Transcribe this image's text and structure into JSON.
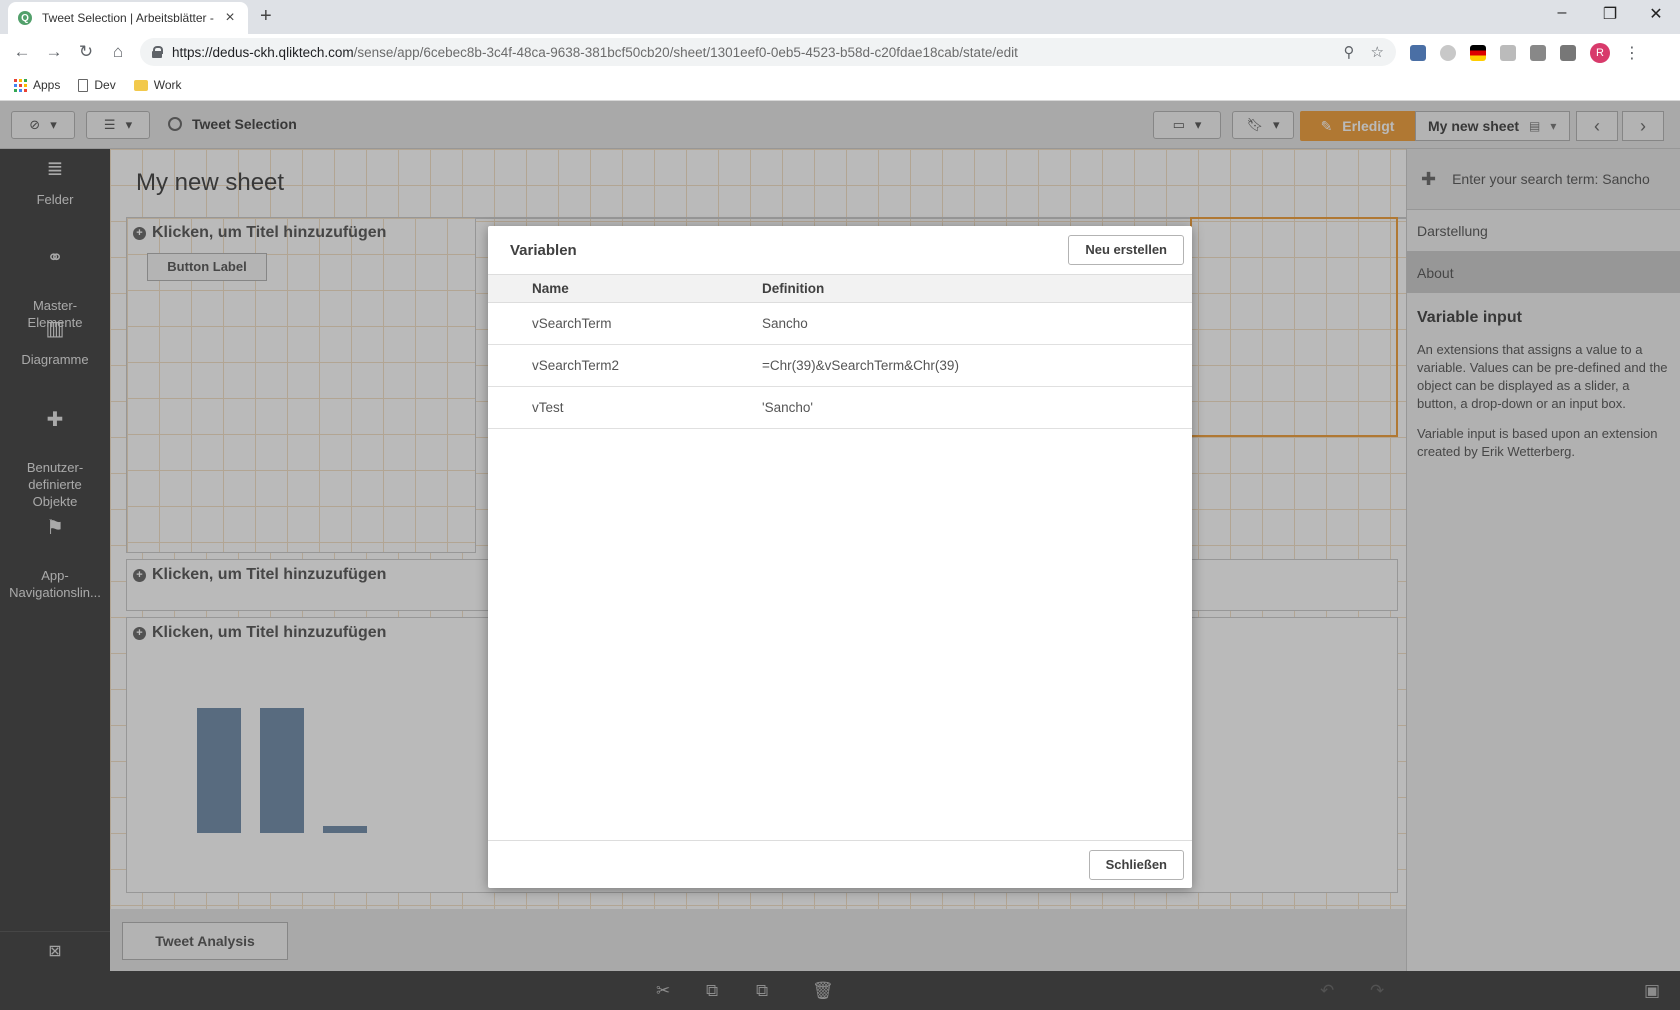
{
  "browser": {
    "tab_title": "Tweet Selection | Arbeitsblätter -",
    "url_host": "https://dedus-ckh.qliktech.com",
    "url_path": "/sense/app/6cebec8b-3c4f-48ca-9638-381bcf50cb20/sheet/1301eef0-0eb5-4523-b58d-c20fdae18cab/state/edit",
    "profile_initial": "R",
    "bookmarks": [
      "Apps",
      "Dev",
      "Work"
    ]
  },
  "qlik": {
    "app_title": "Tweet Selection",
    "done_label": "Erledigt",
    "sheet_name": "My new sheet",
    "left_panel": [
      {
        "label": "Felder",
        "icon": "database-icon"
      },
      {
        "label": "Master-\nElemente",
        "icon": "link-icon"
      },
      {
        "label": "Diagramme",
        "icon": "bar-chart-icon"
      },
      {
        "label": "Benutzer-\ndefinierte\nObjekte",
        "icon": "puzzle-icon"
      },
      {
        "label": "App-\nNavigationslin...",
        "icon": "signpost-icon"
      }
    ],
    "canvas": {
      "sheet_title": "My new sheet",
      "placeholder_title": "Klicken, um Titel hinzuzufügen",
      "button_label": "Button Label",
      "bottom_tab": "Tweet Analysis"
    },
    "right_panel": {
      "search_term": "Enter your search term: Sancho",
      "sections": [
        "Darstellung",
        "About"
      ],
      "heading": "Variable input",
      "para1": "An extensions that assigns a value to a variable. Values can be pre-defined and the object can be displayed as a slider, a button, a drop-down or an input box.",
      "para2": "Variable input is based upon an extension created by Erik Wetterberg."
    }
  },
  "dialog": {
    "title": "Variablen",
    "create_button": "Neu erstellen",
    "close_button": "Schließen",
    "columns": [
      "Name",
      "Definition"
    ],
    "rows": [
      {
        "name": "vSearchTerm",
        "definition": "Sancho"
      },
      {
        "name": "vSearchTerm2",
        "definition": "=Chr(39)&vSearchTerm&Chr(39)"
      },
      {
        "name": "vTest",
        "definition": "'Sancho'"
      }
    ]
  },
  "colors": {
    "accent": "#f19e38",
    "dark_panel": "#404040"
  }
}
